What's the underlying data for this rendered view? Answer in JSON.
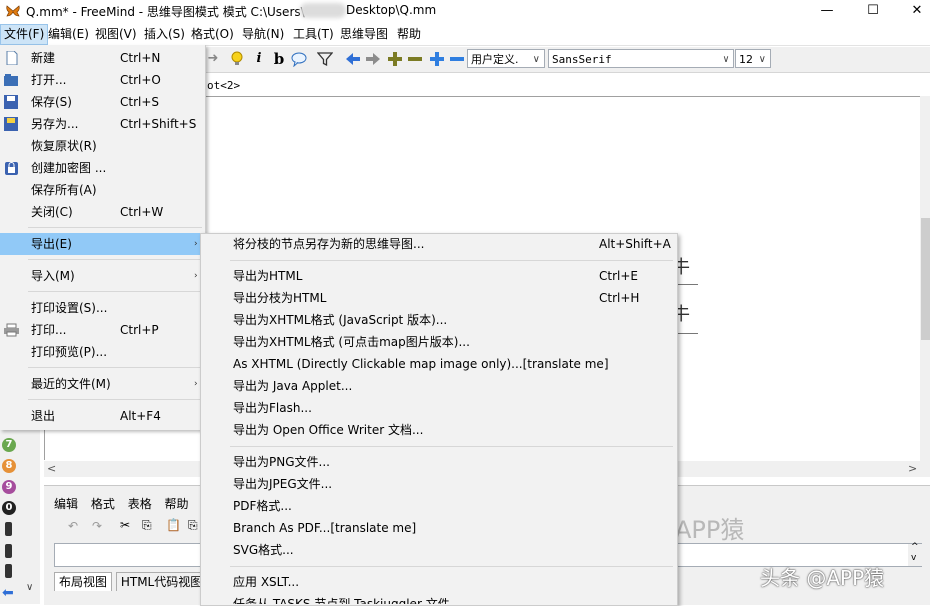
{
  "window": {
    "title": "Q.mm* - FreeMind - 思维导图模式 模式 C:\\Users\\",
    "title_path_end": "Desktop\\Q.mm",
    "minimize": "—",
    "maximize": "☐",
    "close": "✕"
  },
  "menubar": {
    "items": [
      "文件(F)",
      "编辑(E)",
      "视图(V)",
      "插入(S)",
      "格式(O)",
      "导航(N)",
      "工具(T)",
      "思维导图",
      "帮助"
    ]
  },
  "toolbar": {
    "style_combo": "用户定义.",
    "font_combo": "SansSerif",
    "size_combo": "12",
    "icons": [
      "bulb-icon",
      "info-icon",
      "bold-icon",
      "speech-bubble-icon",
      "filter-icon",
      "arrow-left-icon",
      "arrow-right-icon",
      "plus-olive-icon",
      "minus-olive-icon",
      "plus-blue-icon",
      "minus-blue-icon"
    ]
  },
  "map": {
    "tab_label": "ot<2>",
    "node_glyph_1": "牛",
    "node_glyph_2": "牛"
  },
  "file_menu": {
    "items": [
      {
        "label": "新建",
        "shortcut": "Ctrl+N"
      },
      {
        "label": "打开...",
        "shortcut": "Ctrl+O"
      },
      {
        "label": "保存(S)",
        "shortcut": "Ctrl+S"
      },
      {
        "label": "另存为...",
        "shortcut": "Ctrl+Shift+S"
      },
      {
        "label": "恢复原状(R)",
        "shortcut": ""
      },
      {
        "label": "创建加密图 ...",
        "shortcut": ""
      },
      {
        "label": "保存所有(A)",
        "shortcut": ""
      },
      {
        "label": "关闭(C)",
        "shortcut": "Ctrl+W"
      },
      {
        "label": "导出(E)",
        "shortcut": ""
      },
      {
        "label": "导入(M)",
        "shortcut": ""
      },
      {
        "label": "打印设置(S)...",
        "shortcut": ""
      },
      {
        "label": "打印...",
        "shortcut": "Ctrl+P"
      },
      {
        "label": "打印预览(P)...",
        "shortcut": ""
      },
      {
        "label": "最近的文件(M)",
        "shortcut": ""
      },
      {
        "label": "退出",
        "shortcut": "Alt+F4"
      }
    ]
  },
  "export_menu": {
    "items": [
      {
        "label": "将分枝的节点另存为新的思维导图...",
        "shortcut": "Alt+Shift+A"
      },
      {
        "label": "导出为HTML",
        "shortcut": "Ctrl+E"
      },
      {
        "label": "导出分枝为HTML",
        "shortcut": "Ctrl+H"
      },
      {
        "label": "导出为XHTML格式 (JavaScript 版本)...",
        "shortcut": ""
      },
      {
        "label": "导出为XHTML格式 (可点击map图片版本)...",
        "shortcut": ""
      },
      {
        "label": "As XHTML (Directly Clickable map image only)...[translate me]",
        "shortcut": ""
      },
      {
        "label": "导出为 Java Applet...",
        "shortcut": ""
      },
      {
        "label": "导出为Flash...",
        "shortcut": ""
      },
      {
        "label": "导出为 Open Office Writer 文档...",
        "shortcut": ""
      },
      {
        "label": "导出为PNG文件...",
        "shortcut": ""
      },
      {
        "label": "导出为JPEG文件...",
        "shortcut": ""
      },
      {
        "label": "PDF格式...",
        "shortcut": ""
      },
      {
        "label": "Branch As PDF...[translate me]",
        "shortcut": ""
      },
      {
        "label": "SVG格式...",
        "shortcut": ""
      },
      {
        "label": "应用 XSLT...",
        "shortcut": ""
      },
      {
        "label": "任务从 TASKS 节点到 Taskjuggler 文件",
        "shortcut": ""
      }
    ]
  },
  "left_strip": {
    "numbers": [
      "7",
      "8",
      "9",
      "0"
    ]
  },
  "notes": {
    "menu": [
      "编辑",
      "格式",
      "表格",
      "帮助"
    ],
    "tabs": [
      "布局视图",
      "HTML代码视图"
    ]
  },
  "watermarks": {
    "app": "APP猿",
    "toutiao": "头条 @APP猿"
  },
  "colors": {
    "highlight": "#91c9f7",
    "menu_bg": "#f2f2f2",
    "file_menu_active": "#cde4f7"
  }
}
